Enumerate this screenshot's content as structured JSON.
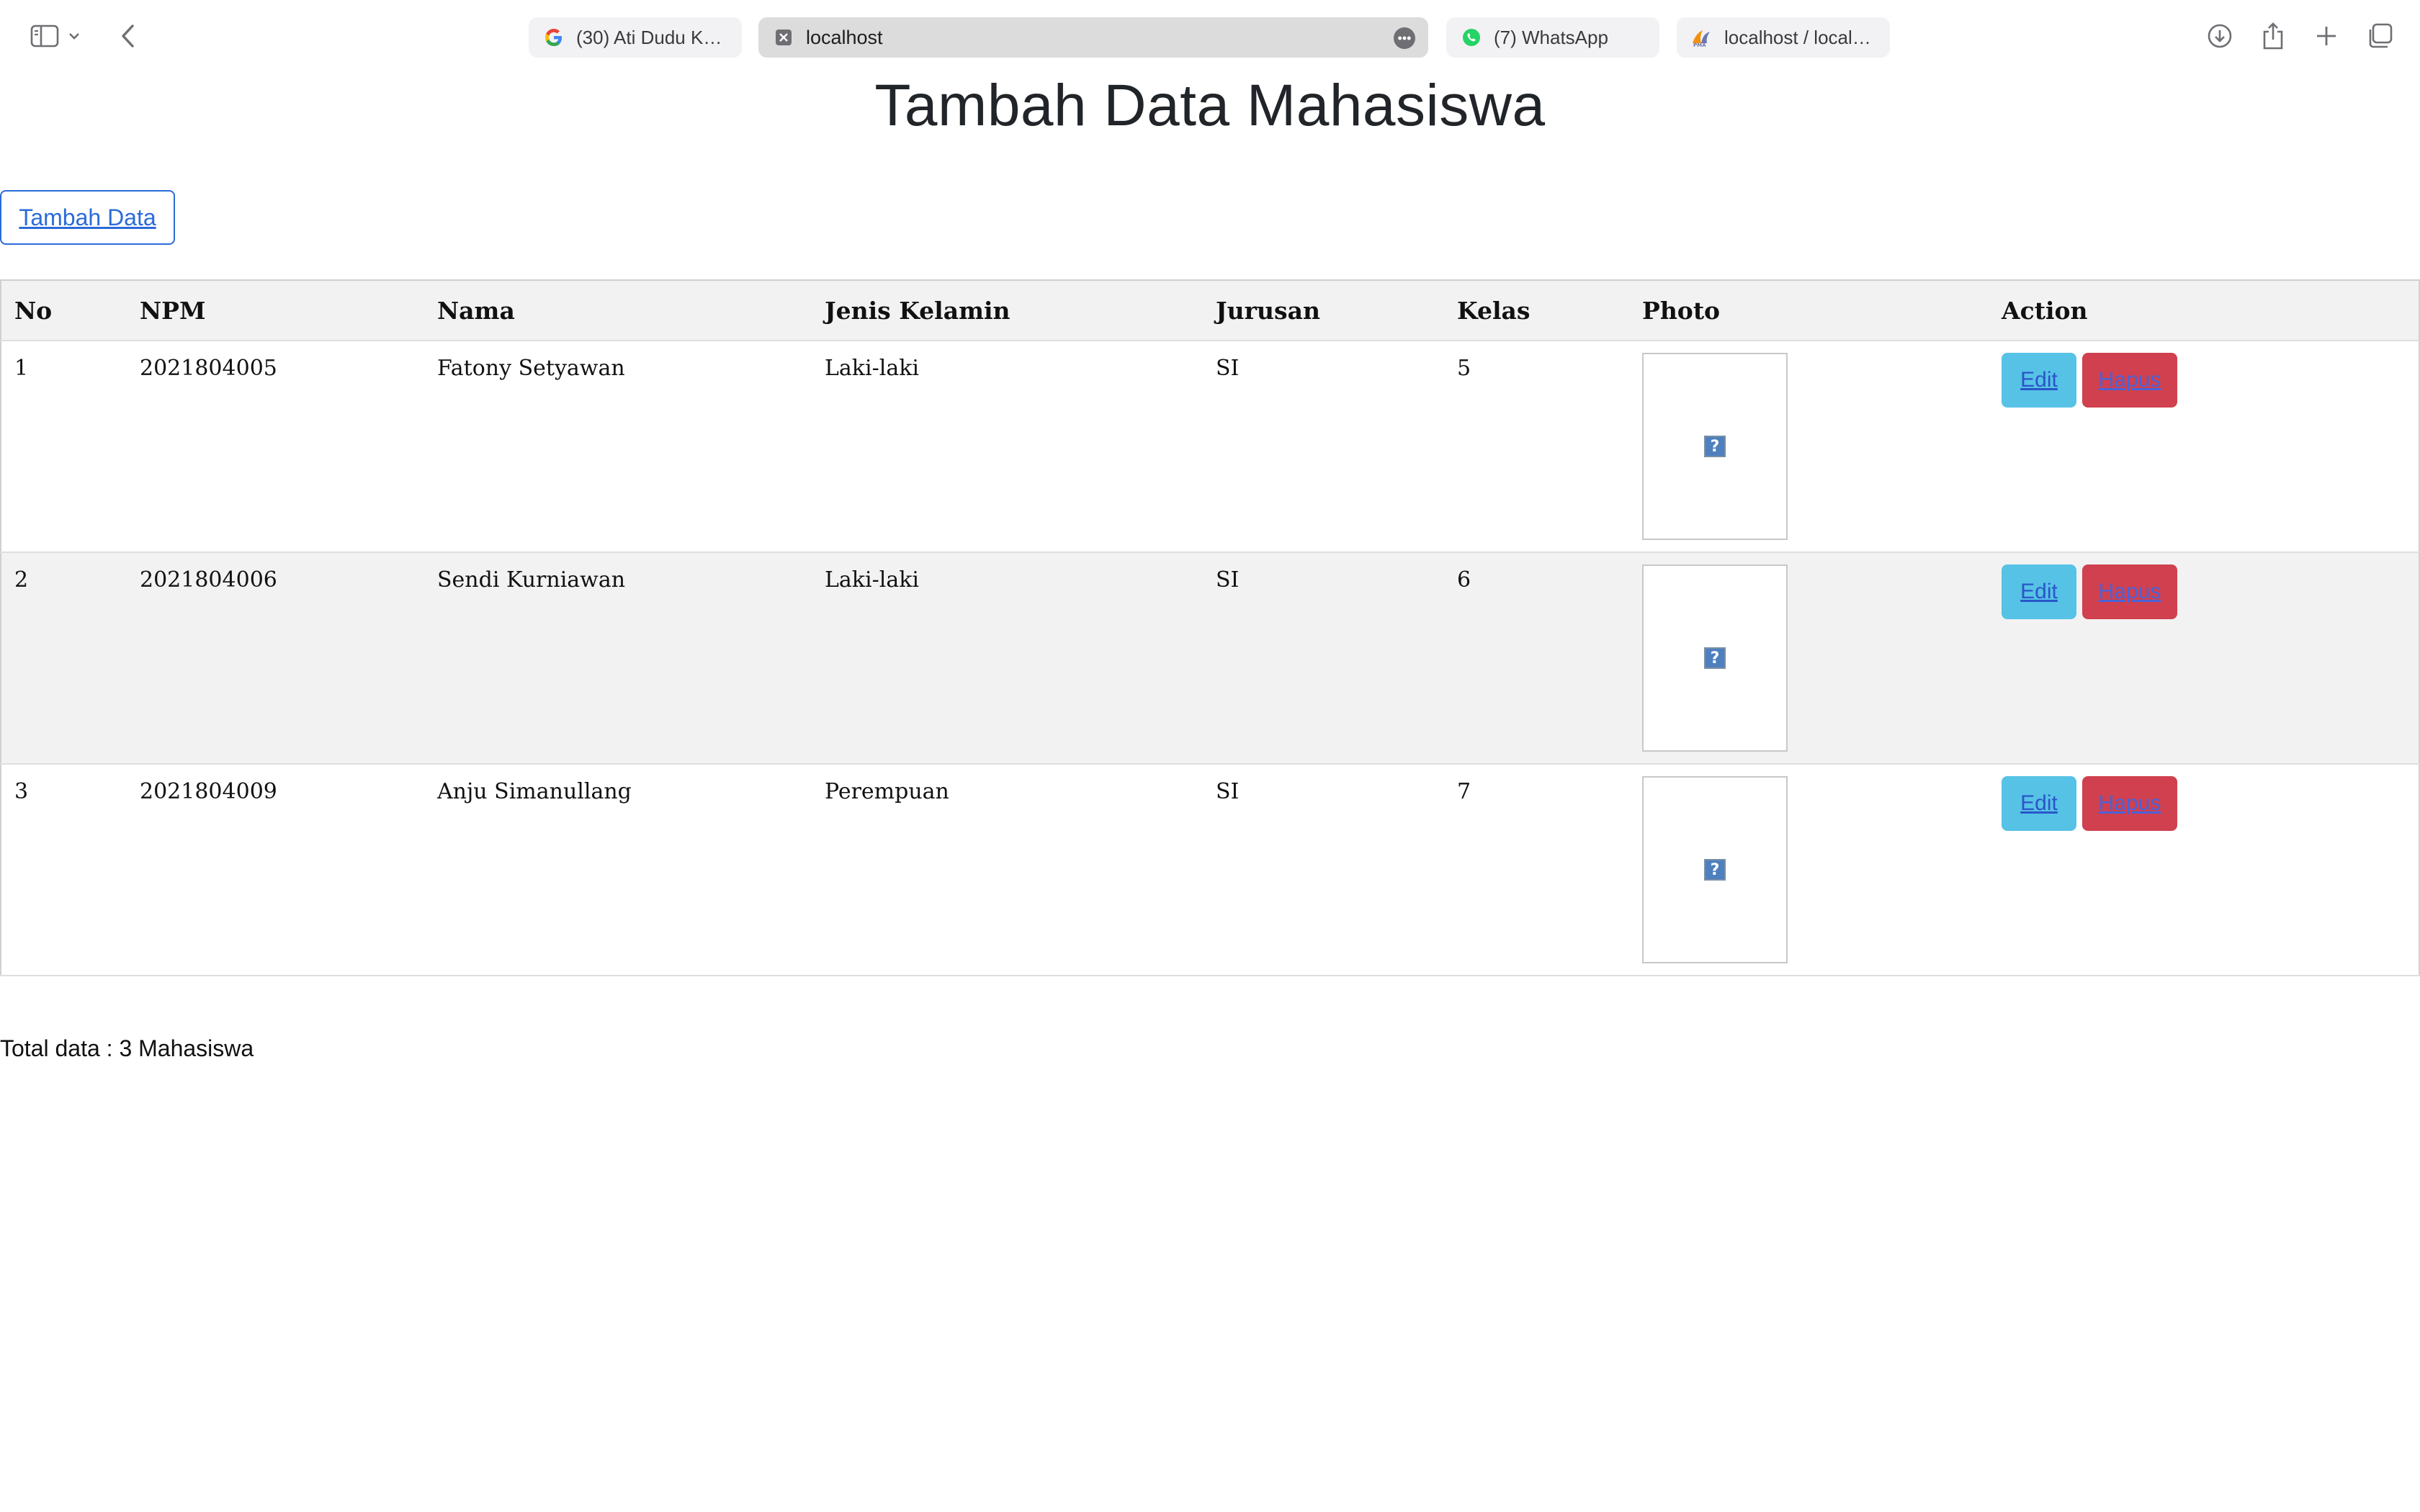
{
  "browser": {
    "tabs": [
      {
        "title": "(30) Ati Dudu Kos...",
        "icon": "google-icon",
        "active": false
      },
      {
        "title": "localhost",
        "icon": "close-tab-icon",
        "active": true
      },
      {
        "title": "(7) WhatsApp",
        "icon": "whatsapp-icon",
        "active": false
      },
      {
        "title": "localhost / localh...",
        "icon": "phpmyadmin-icon",
        "active": false
      }
    ]
  },
  "page": {
    "title": "Tambah Data Mahasiswa",
    "add_button": "Tambah Data",
    "total": "Total data : 3 Mahasiswa"
  },
  "table": {
    "headers": [
      "No",
      "NPM",
      "Nama",
      "Jenis Kelamin",
      "Jurusan",
      "Kelas",
      "Photo",
      "Action"
    ],
    "rows": [
      {
        "no": "1",
        "npm": "2021804005",
        "nama": "Fatony Setyawan",
        "jk": "Laki-laki",
        "jurusan": "SI",
        "kelas": "5"
      },
      {
        "no": "2",
        "npm": "2021804006",
        "nama": "Sendi Kurniawan",
        "jk": "Laki-laki",
        "jurusan": "SI",
        "kelas": "6"
      },
      {
        "no": "3",
        "npm": "2021804009",
        "nama": "Anju Simanullang",
        "jk": "Perempuan",
        "jurusan": "SI",
        "kelas": "7"
      }
    ],
    "edit_label": "Edit",
    "delete_label": "Hapus",
    "broken_image_glyph": "?"
  },
  "colors": {
    "edit_button": "#56c2e6",
    "delete_button": "#d0404e",
    "add_button_border": "#2a6bd8"
  }
}
